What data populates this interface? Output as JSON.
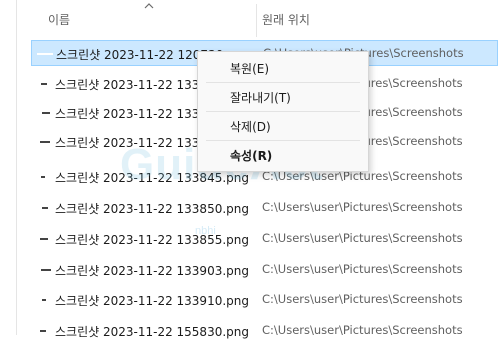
{
  "header": {
    "name_col": "이름",
    "location_col": "원래 위치"
  },
  "rows": [
    {
      "name": "스크린샷 2023-11-22 120730.png",
      "location": "C:\\Users\\user\\Pictures\\Screenshots",
      "selected": true
    },
    {
      "name": "스크린샷 2023-11-22 133",
      "location": "C:\\Users\\user\\Pictures\\Screenshots",
      "selected": false
    },
    {
      "name": "스크린샷 2023-11-22 133",
      "location": "C:\\Users\\user\\Pictures\\Screenshots",
      "selected": false
    },
    {
      "name": "스크린샷 2023-11-22 133",
      "location": "C:\\Users\\user\\Pictures\\Screenshots",
      "selected": false
    },
    {
      "name": "스크린샷 2023-11-22 133845.png",
      "location": "C:\\Users\\user\\Pictures\\Screenshots",
      "selected": false
    },
    {
      "name": "스크린샷 2023-11-22 133850.png",
      "location": "C:\\Users\\user\\Pictures\\Screenshots",
      "selected": false
    },
    {
      "name": "스크린샷 2023-11-22 133855.png",
      "location": "C:\\Users\\user\\Pictures\\Screenshots",
      "selected": false
    },
    {
      "name": "스크린샷 2023-11-22 133903.png",
      "location": "C:\\Users\\user\\Pictures\\Screenshots",
      "selected": false
    },
    {
      "name": "스크린샷 2023-11-22 133910.png",
      "location": "C:\\Users\\user\\Pictures\\Screenshots",
      "selected": false
    },
    {
      "name": "스크린샷 2023-11-22 155830.png",
      "location": "C:\\Users\\user\\Pictures\\Screenshots",
      "selected": false
    }
  ],
  "context_menu": {
    "items": [
      {
        "label": "복원(E)",
        "bold": false
      },
      {
        "label": "잘라내기(T)",
        "bold": false
      },
      {
        "label": "삭제(D)",
        "bold": false
      },
      {
        "label": "속성(R)",
        "bold": true
      }
    ]
  },
  "watermark": {
    "text": "GuideAct",
    "sub": "nbhi"
  },
  "colors": {
    "selection_bg": "#cce8ff",
    "selection_border": "#99d1ff",
    "menu_bg": "#f9f9f9"
  }
}
